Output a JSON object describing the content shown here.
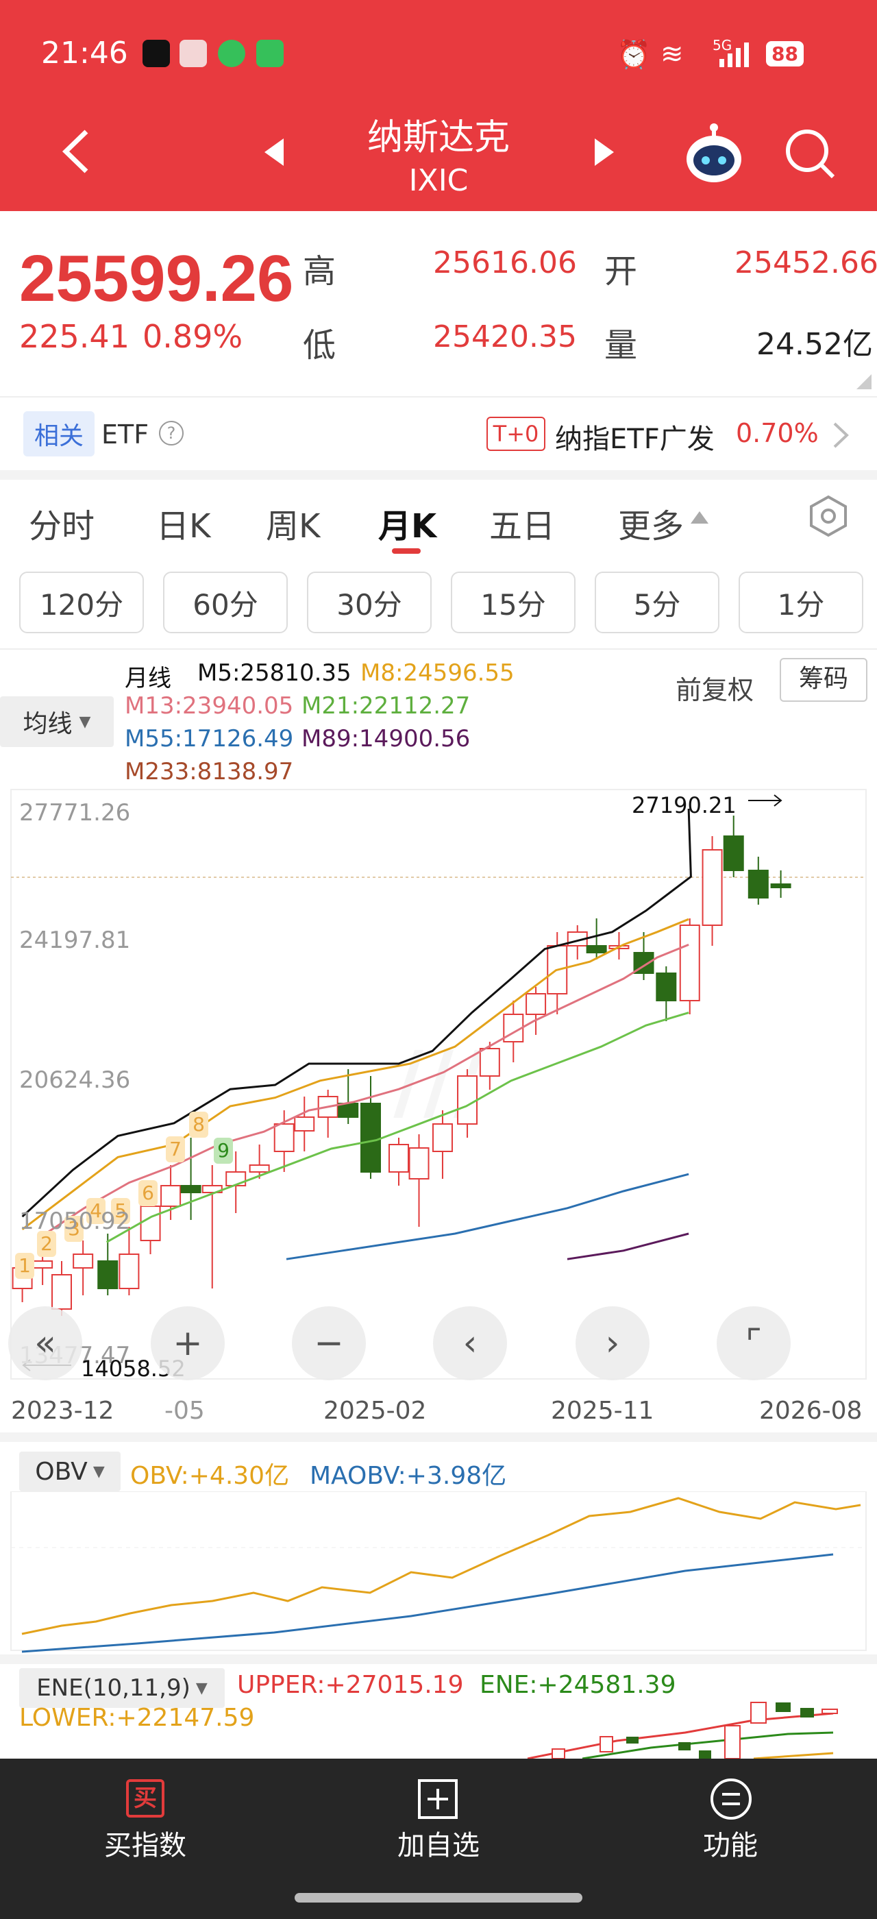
{
  "status_bar": {
    "time": "21:46",
    "network": "5G",
    "battery": "88"
  },
  "header": {
    "title": "纳斯达克",
    "code": "IXIC"
  },
  "quote": {
    "price": "25599.26",
    "change": "225.41",
    "change_pct": "0.89%",
    "high_label": "高",
    "high": "25616.06",
    "low_label": "低",
    "low": "25420.35",
    "open_label": "开",
    "open": "25452.66",
    "volume_label": "量",
    "volume": "24.52亿"
  },
  "related": {
    "tag": "相关",
    "etf": "ETF",
    "t0": "T+0",
    "etf_name": "纳指ETF广发",
    "etf_pct": "0.70%"
  },
  "tabs": [
    "分时",
    "日K",
    "周K",
    "月K",
    "五日",
    "更多"
  ],
  "minute_tabs": [
    "120分",
    "60分",
    "30分",
    "15分",
    "5分",
    "1分"
  ],
  "chart": {
    "indicator_select": "均线",
    "ma_title": "月线",
    "ma5": "M5:25810.35",
    "ma8": "M8:24596.55",
    "ma13": "M13:23940.05",
    "ma21": "M21:22112.27",
    "ma55": "M55:17126.49",
    "ma89": "M89:14900.56",
    "ma233": "M233:8138.97",
    "adjust": "前复权",
    "chips": "筹码",
    "y_labels": [
      "27771.26",
      "24197.81",
      "20624.36",
      "17050.92",
      "13477.47"
    ],
    "x_labels": [
      "2023-12",
      "-05",
      "2025-02",
      "2025-11",
      "2026-08"
    ],
    "max_label": "27190.21",
    "min_label": "14058.52",
    "td_counts": [
      "1",
      "2",
      "3",
      "4",
      "5",
      "6",
      "7",
      "8",
      "9"
    ],
    "colors": {
      "up": "#e23b3b",
      "down": "#2b6a17",
      "ma5": "#111111",
      "ma8": "#e3a21a",
      "ma13": "#e0727e",
      "ma21": "#6cc24a",
      "ma55": "#2a6fb0",
      "ma89": "#5b1a5b"
    }
  },
  "obv": {
    "select": "OBV",
    "obv": "OBV:+4.30亿",
    "maobv": "MAOBV:+3.98亿"
  },
  "ene": {
    "select": "ENE(10,11,9)",
    "upper": "UPPER:+27015.19",
    "ene": "ENE:+24581.39",
    "lower": "LOWER:+22147.59"
  },
  "bottom_bar": {
    "buy": "买指数",
    "add": "加自选",
    "func": "功能",
    "buy_icon_char": "买"
  }
}
